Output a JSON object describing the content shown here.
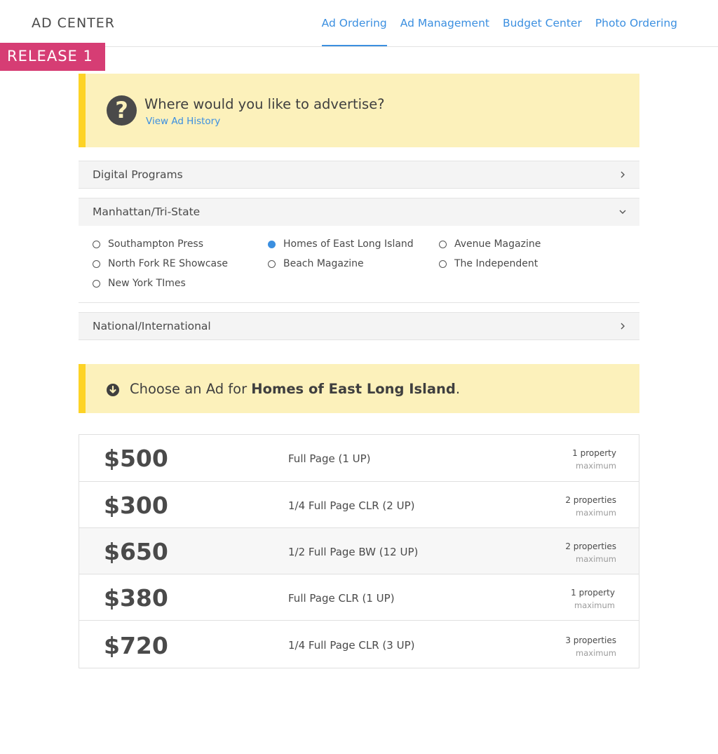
{
  "header": {
    "brand": "AD CENTER",
    "nav": [
      "Ad Ordering",
      "Ad Management",
      "Budget Center",
      "Photo Ordering"
    ],
    "active_nav": "Ad Ordering"
  },
  "release_badge": "RELEASE 1",
  "question": {
    "icon": "question-circle-icon",
    "title": "Where would you like to advertise?",
    "link": "View Ad History"
  },
  "sections": {
    "digital": {
      "label": "Digital Programs",
      "state": "collapsed"
    },
    "manhattan": {
      "label": "Manhattan/Tri-State",
      "state": "expanded",
      "options": [
        "Southampton Press",
        "Homes of East Long Island",
        "Avenue Magazine",
        "North Fork RE Showcase",
        "Beach Magazine",
        "The Independent",
        "New York TImes"
      ],
      "selected": "Homes of East Long Island"
    },
    "national": {
      "label": "National/International",
      "state": "collapsed"
    }
  },
  "choose": {
    "icon": "arrow-down-circle-icon",
    "prefix": "Choose an Ad for ",
    "publication": "Homes of East Long Island",
    "suffix": "."
  },
  "ads": [
    {
      "price": "$500",
      "name": "Full Page (1 UP)",
      "properties": "1 property",
      "max_label": "maximum"
    },
    {
      "price": "$300",
      "name": "1/4 Full Page CLR (2 UP)",
      "properties": "2 properties",
      "max_label": "maximum"
    },
    {
      "price": "$650",
      "name": "1/2 Full Page BW (12 UP)",
      "properties": "2 properties",
      "max_label": "maximum"
    },
    {
      "price": "$380",
      "name": "Full Page CLR (1 UP)",
      "properties": "1 property",
      "max_label": "maximum"
    },
    {
      "price": "$720",
      "name": "1/4 Full Page CLR (3 UP)",
      "properties": "3 properties",
      "max_label": "maximum"
    }
  ],
  "colors": {
    "accent": "#3b8fe0",
    "notice_bg": "#fcf1bb",
    "notice_bar": "#fdd326",
    "release_badge": "#d63d74"
  }
}
